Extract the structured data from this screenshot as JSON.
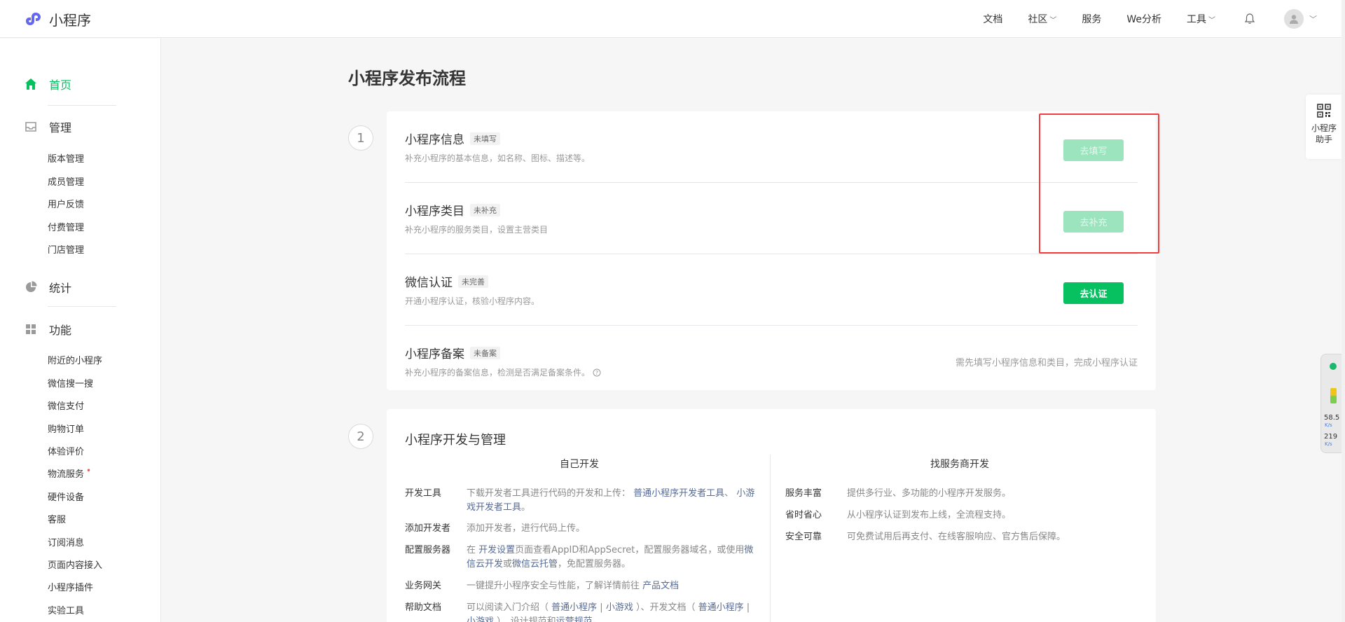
{
  "brand": {
    "name": "小程序"
  },
  "topnav": {
    "docs": "文档",
    "community": "社区",
    "service": "服务",
    "analytics": "We分析",
    "tools": "工具"
  },
  "sidebar": {
    "home": "首页",
    "manage": "管理",
    "manage_items": [
      "版本管理",
      "成员管理",
      "用户反馈",
      "付费管理",
      "门店管理"
    ],
    "stats": "统计",
    "features": "功能",
    "feature_items": [
      "附近的小程序",
      "微信搜一搜",
      "微信支付",
      "购物订单",
      "体验评价",
      "物流服务",
      "硬件设备",
      "客服",
      "订阅消息",
      "页面内容接入",
      "小程序插件",
      "实验工具"
    ],
    "feature_dot_marker": "•"
  },
  "main": {
    "title": "小程序发布流程",
    "step1": {
      "num": "1",
      "rows": [
        {
          "title": "小程序信息",
          "tag": "未填写",
          "desc": "补充小程序的基本信息，如名称、图标、描述等。",
          "action": "去填写"
        },
        {
          "title": "小程序类目",
          "tag": "未补充",
          "desc": "补充小程序的服务类目，设置主营类目",
          "action": "去补充"
        },
        {
          "title": "微信认证",
          "tag": "未完善",
          "desc": "开通小程序认证，核验小程序内容。",
          "action": "去认证"
        },
        {
          "title": "小程序备案",
          "tag": "未备案",
          "desc": "补充小程序的备案信息，检测是否满足备案条件。",
          "note": "需先填写小程序信息和类目，完成小程序认证"
        }
      ]
    },
    "step2": {
      "num": "2",
      "title": "小程序开发与管理",
      "self_dev": {
        "title": "自己开发",
        "items": [
          {
            "key": "开发工具",
            "text": "下载开发者工具进行代码的开发和上传：",
            "link1": "普通小程序开发者工具",
            "sep": "、",
            "link2": "小游戏开发者工具",
            "tail": "。"
          },
          {
            "key": "添加开发者",
            "text": "添加开发者，进行代码上传。"
          },
          {
            "key": "配置服务器",
            "pre": "在 ",
            "link1": "开发设置",
            "mid": "页面查看AppID和AppSecret，配置服务器域名，或使用",
            "link2": "微信云开发",
            "mid2": "或",
            "link3": "微信云托管",
            "tail": "，免配置服务器。"
          },
          {
            "key": "业务网关",
            "text": "一键提升小程序安全与性能，了解详情前往 ",
            "link1": "产品文档"
          },
          {
            "key": "帮助文档",
            "text": "可以阅读入门介绍（ ",
            "link1": "普通小程序",
            "sep": " | ",
            "link2": "小游戏",
            "tail": " ）、开发文档（ ",
            "link3": "普通小程序",
            "sep2": " | ",
            "link4": "小游戏",
            "tail2": " ）、设计规范和",
            "link5": "运营规范",
            "tail3": "。"
          }
        ]
      },
      "provider_dev": {
        "title": "找服务商开发",
        "items": [
          {
            "key": "服务丰富",
            "text": "提供多行业、多功能的小程序开发服务。"
          },
          {
            "key": "省时省心",
            "text": "从小程序认证到发布上线，全流程支持。"
          },
          {
            "key": "安全可靠",
            "text": "可免费试用后再支付、在线客服响应、官方售后保障。"
          }
        ]
      }
    }
  },
  "assistant": {
    "line1": "小程序",
    "line2": "助手"
  },
  "speed_widget": {
    "value1": "58.5",
    "unit1": "K/s",
    "value2": "219",
    "unit2": "K/s"
  },
  "colors": {
    "brand_green": "#07c160",
    "disabled_green": "#9be4be",
    "highlight_red": "#f53d3d",
    "link_blue": "#576b95"
  }
}
